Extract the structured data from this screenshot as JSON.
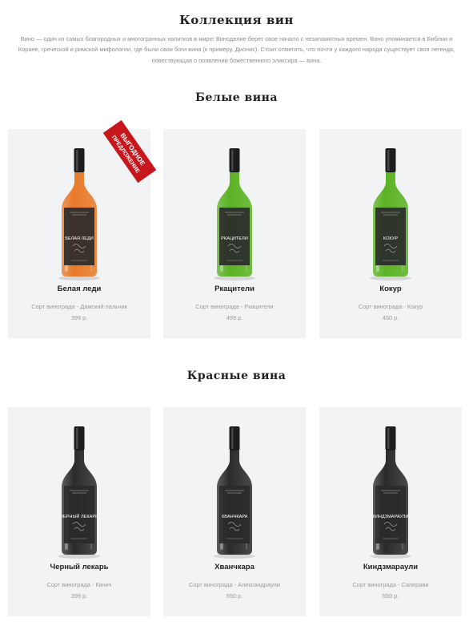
{
  "page": {
    "title": "Коллекция вин",
    "intro_lines": [
      "Вино — один из самых благородных и многогранных напитков в мире! Виноделие берет свое начало с незапамятных времен. Вино упоминается в Библии и",
      "Коране, греческой и римской мифологии, где были свои боги вина (к примеру, Дионис). Стоит отметить, что почти у каждого народа существует своя легенда,",
      "повествующая о появлении божественного эликсира — вина."
    ]
  },
  "sections": [
    {
      "title": "Белые вина",
      "products": [
        {
          "name": "Белая леди",
          "variety": "Сорт винограда - Дамский пальчик",
          "price": "399 р.",
          "label_text": "БЕЛАЯ ЛЕДИ",
          "bottle_color": "#e87a2a",
          "badge_line1": "ВЫГОДНОЕ",
          "badge_line2": "ПРЕДЛОЖЕНИЕ"
        },
        {
          "name": "Ркацители",
          "variety": "Сорт винограда - Ркацители",
          "price": "499 р.",
          "label_text": "РКАЦИТЕЛИ",
          "bottle_color": "#5bb223"
        },
        {
          "name": "Кокур",
          "variety": "Сорт винограда - Кокур",
          "price": "450 р.",
          "label_text": "КОКУР",
          "bottle_color": "#5bb223"
        }
      ]
    },
    {
      "title": "Красные вина",
      "products": [
        {
          "name": "Черный лекарь",
          "variety": "Сорт винограда - Качич",
          "price": "399 р.",
          "label_text": "ЧЕРНЫЙ ЛЕКАРЬ",
          "bottle_color": "#2b2b2b"
        },
        {
          "name": "Хванчкара",
          "variety": "Сорт винограда - Александраули",
          "price": "550 р.",
          "label_text": "ХВАНЧКАРА",
          "bottle_color": "#2b2b2b"
        },
        {
          "name": "Киндзмараули",
          "variety": "Сорт винограда - Саперави",
          "price": "550 р.",
          "label_text": "КИНДЗМАРАУЛИ",
          "bottle_color": "#2b2b2b"
        }
      ]
    }
  ],
  "colors": {
    "badge_red": "#c8161d",
    "card_bg": "#f2f3f4",
    "label_dark": "#2a2a2a"
  }
}
